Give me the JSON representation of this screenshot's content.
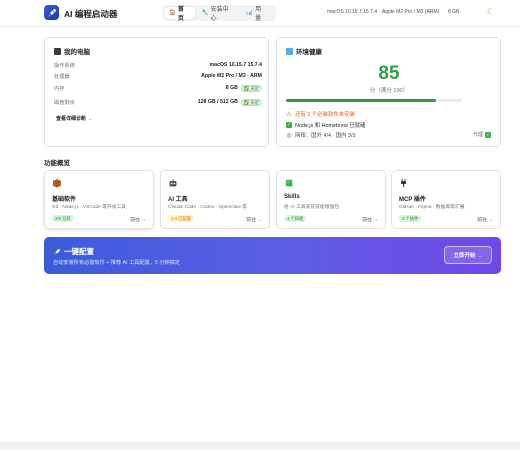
{
  "app": {
    "title": "AI 编程启动器"
  },
  "nav": {
    "tabs": [
      {
        "icon": "🏠",
        "label": "首页",
        "active": true
      },
      {
        "icon": "🔧",
        "label": "安装中心",
        "active": false
      },
      {
        "icon": "📊",
        "label": "用量",
        "active": false
      }
    ]
  },
  "header_info": {
    "os": "macOS 10.15.7 15.7.4",
    "chip": "Apple M2 Pro / M3 (ARM)",
    "memory": "8 GB"
  },
  "my_computer": {
    "title": "我的电脑",
    "rows": [
      {
        "key": "操作系统",
        "value": "macOS 10.15.7 15.7.4",
        "badge": ""
      },
      {
        "key": "处理器",
        "value": "Apple M2 Pro / M3 · ARM",
        "badge": ""
      },
      {
        "key": "内存",
        "value": "8 GB",
        "badge": "✅ 充足"
      },
      {
        "key": "磁盘剩余",
        "value": "128 GB / 512 GB",
        "badge": "✅ 充足"
      }
    ],
    "link": "查看详细诊断 →"
  },
  "health": {
    "title": "环境健康",
    "score": "85",
    "score_sub": "分（满分 100）",
    "progress": 0.85,
    "items": [
      {
        "icon": "warning-icon",
        "glyph": "⚠",
        "color": "#e8590c",
        "text": "还有 2 个必装软件未安装"
      },
      {
        "icon": "check-icon",
        "glyph": "✓",
        "color": "#37b24d",
        "text": "Node.js 和 Homebrew 已就绪"
      },
      {
        "icon": "globe-icon",
        "glyph": "◎",
        "color": "#495057",
        "text": "网络：国外 4/4 · 国内 3/3"
      }
    ],
    "proxy_label": "代理"
  },
  "features": {
    "title": "功能概览",
    "cards": [
      {
        "icon": "box-icon",
        "name": "基础软件",
        "desc": "Git · Node.js · VSCode 等开发工具",
        "badge": "2/5 已装",
        "badge_bg": "#d3f9d8",
        "badge_fg": "#2b8a3e",
        "go": "前往 →"
      },
      {
        "icon": "robot-icon",
        "name": "AI 工具",
        "desc": "Claude Code · Codex · OpenClaw 等",
        "badge": "1/4 已配置",
        "badge_bg": "#fff3bf",
        "badge_fg": "#e67700",
        "go": "前往 →"
      },
      {
        "icon": "clover-icon",
        "name": "Skills",
        "desc": "给 AI 工具安装技能增强包",
        "badge": "4 个技能",
        "badge_bg": "#d3f9d8",
        "badge_fg": "#2b8a3e",
        "go": "前往 →"
      },
      {
        "icon": "plug-icon",
        "name": "MCP 插件",
        "desc": "GitHub · Figma · 数据库等扩展",
        "badge": "3 个插件",
        "badge_bg": "#d3f9d8",
        "badge_fg": "#2b8a3e",
        "go": "前往 →"
      }
    ]
  },
  "banner": {
    "title": "一键配置",
    "desc": "自动安装所有必装软件 + 推荐 AI 工具配置，5 分钟搞定",
    "button": "立即开始 →",
    "colors": [
      "#3b5bdb",
      "#7048e8"
    ]
  }
}
